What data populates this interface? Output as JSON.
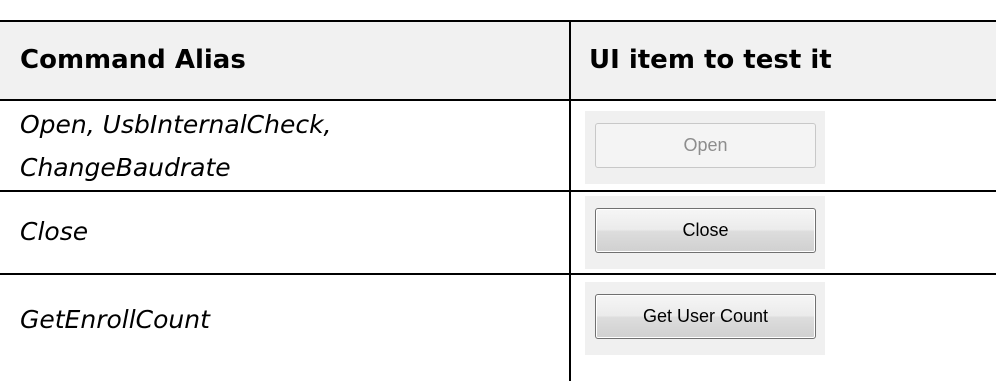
{
  "table": {
    "headers": {
      "command_alias": "Command Alias",
      "ui_item": "UI item to test it"
    },
    "rows": [
      {
        "alias_line1": "Open, UsbInternalCheck,",
        "alias_line2": "ChangeBaudrate",
        "button_label": "Open",
        "button_state": "disabled"
      },
      {
        "alias_line1": "Close",
        "button_label": "Close",
        "button_state": "enabled"
      },
      {
        "alias_line1": "GetEnrollCount",
        "button_label": "Get User Count",
        "button_state": "enabled"
      }
    ]
  }
}
